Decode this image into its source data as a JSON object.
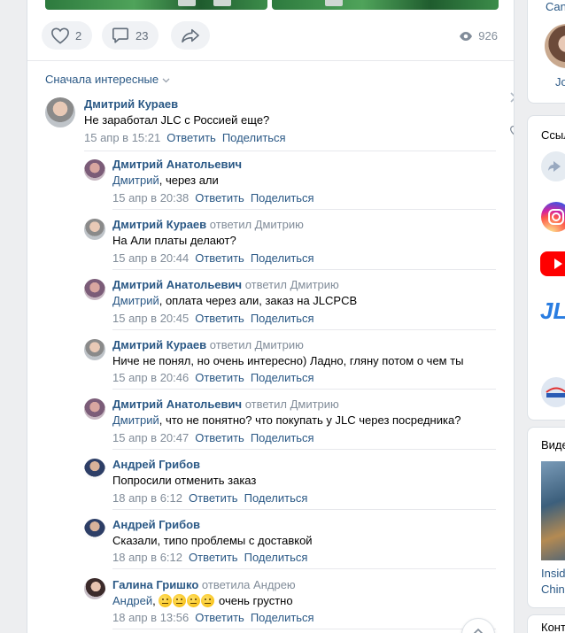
{
  "post": {
    "likes": "2",
    "comments": "23",
    "views": "926"
  },
  "sort_label": "Сначала интересные",
  "comments": [
    {
      "author": "Дмитрий Кураев",
      "replied": "",
      "mention": "",
      "text": "Не заработал JLC с Россией еще?",
      "date": "15 апр в 15:21",
      "reply": "Ответить",
      "share": "Поделиться"
    },
    {
      "author": "Дмитрий Анатольевич",
      "replied": "",
      "mention": "Дмитрий",
      "text": ", через али",
      "date": "15 апр в 20:38",
      "reply": "Ответить",
      "share": "Поделиться"
    },
    {
      "author": "Дмитрий Кураев",
      "replied": "ответил Дмитрию",
      "mention": "",
      "text": "На Али платы делают?",
      "date": "15 апр в 20:44",
      "reply": "Ответить",
      "share": "Поделиться"
    },
    {
      "author": "Дмитрий Анатольевич",
      "replied": "ответил Дмитрию",
      "mention": "Дмитрий",
      "text": ", оплата через али, заказ на JLCPCB",
      "date": "15 апр в 20:45",
      "reply": "Ответить",
      "share": "Поделиться"
    },
    {
      "author": "Дмитрий Кураев",
      "replied": "ответил Дмитрию",
      "mention": "",
      "text": "Ниче не понял, но очень интересно) Ладно, гляну потом о чем ты",
      "date": "15 апр в 20:46",
      "reply": "Ответить",
      "share": "Поделиться"
    },
    {
      "author": "Дмитрий Анатольевич",
      "replied": "ответил Дмитрию",
      "mention": "Дмитрий",
      "text": ", что не понятно? что покупать у JLC через посредника?",
      "date": "15 апр в 20:47",
      "reply": "Ответить",
      "share": "Поделиться"
    },
    {
      "author": "Андрей Грибов",
      "replied": "",
      "mention": "",
      "text": "Попросили отменить заказ",
      "date": "18 апр в 6:12",
      "reply": "Ответить",
      "share": "Поделиться"
    },
    {
      "author": "Андрей Грибов",
      "replied": "",
      "mention": "",
      "text": "Сказали, типо проблемы с доставкой",
      "date": "18 апр в 6:12",
      "reply": "Ответить",
      "share": "Поделиться"
    },
    {
      "author": "Галина Гришко",
      "replied": "ответила Андрею",
      "mention": "Андрей",
      "text": "очень грустно",
      "date": "18 апр в 13:56",
      "reply": "Ответить",
      "share": "Поделиться"
    }
  ],
  "sidebar": {
    "top_partial": "Can",
    "top_name_partial": "Jo",
    "links_title_partial": "Ссыл",
    "videos_title_partial": "Виде",
    "video_caption_1": "Insid",
    "video_caption_2": "China",
    "contacts_title_partial": "Конт"
  },
  "colors": {
    "link": "#2a5885",
    "gray": "#818c99",
    "bg": "#edeef0"
  }
}
